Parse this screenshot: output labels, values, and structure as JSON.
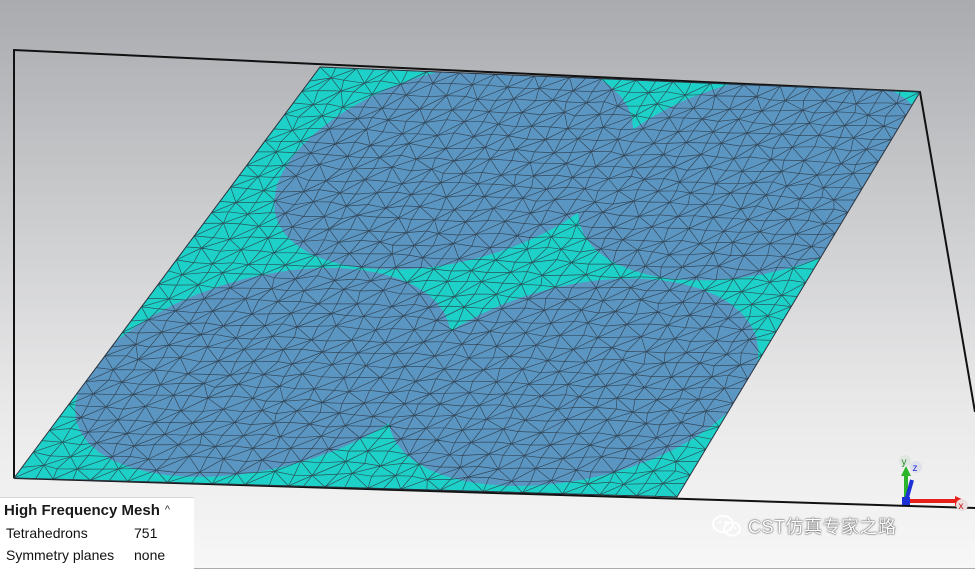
{
  "info_panel": {
    "title": "High Frequency Mesh",
    "collapse_glyph": "^",
    "rows": [
      {
        "key": "Tetrahedrons",
        "value": "751"
      },
      {
        "key": "Symmetry planes",
        "value": "none"
      }
    ]
  },
  "axes": {
    "y": "y",
    "z": "z",
    "x": "x"
  },
  "watermark": {
    "text": "CST仿真专家之路",
    "icon": "wechat-icon"
  },
  "colors": {
    "mesh_patch": "#5b96c2",
    "mesh_gap": "#1ed1c8",
    "mesh_edge": "#2a3440",
    "outline": "#111111",
    "axis_x": "#e8201c",
    "axis_y": "#2bb52b",
    "axis_z": "#1d2fd6"
  }
}
